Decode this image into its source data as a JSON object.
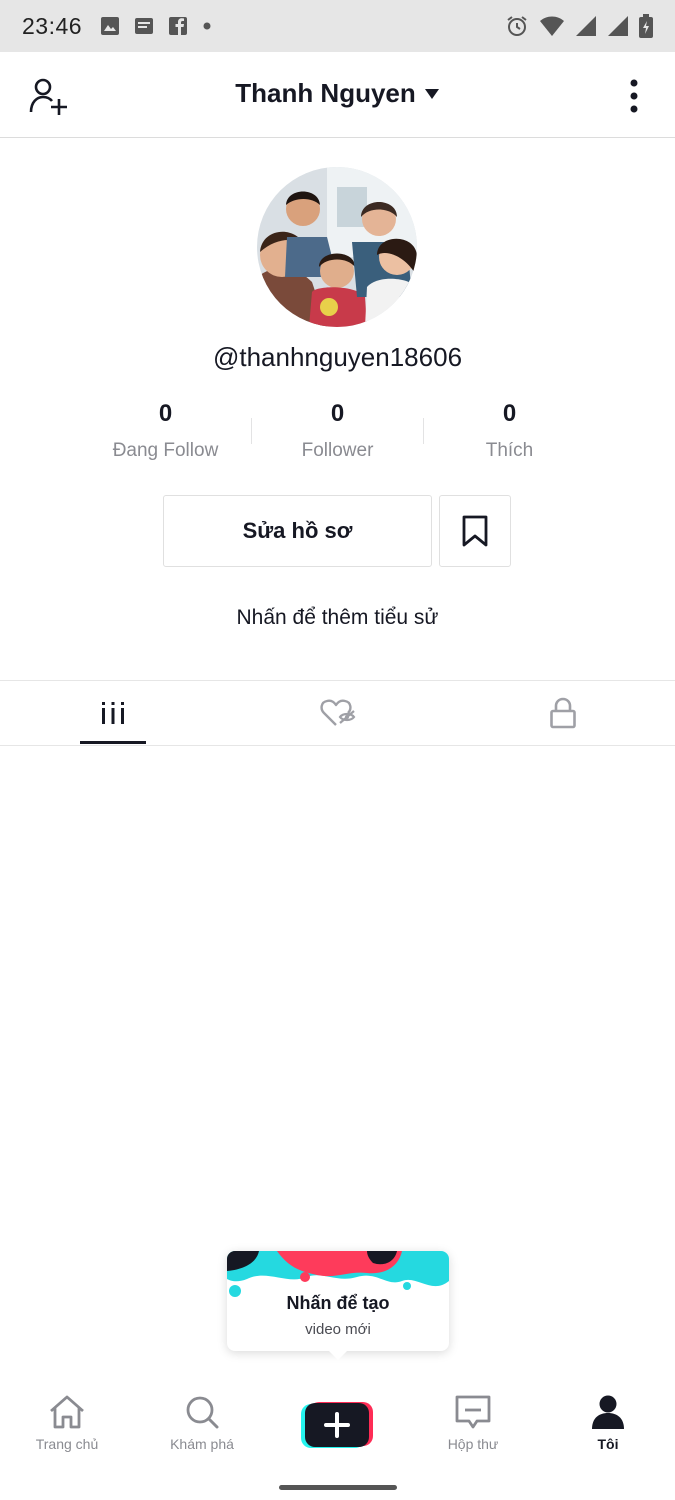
{
  "status_bar": {
    "time": "23:46",
    "left_icons": [
      "image-icon",
      "message-icon",
      "facebook-icon",
      "dot-icon"
    ],
    "right_icons": [
      "alarm-icon",
      "wifi-icon",
      "signal-icon",
      "signal-icon",
      "battery-icon"
    ]
  },
  "header": {
    "title": "Thanh Nguyen",
    "add_user_icon": "add-user-icon",
    "more_icon": "more-vertical-icon"
  },
  "profile": {
    "handle": "@thanhnguyen18606",
    "stats": [
      {
        "value": "0",
        "label": "Đang Follow"
      },
      {
        "value": "0",
        "label": "Follower"
      },
      {
        "value": "0",
        "label": "Thích"
      }
    ],
    "edit_button": "Sửa hồ sơ",
    "bio_prompt": "Nhấn để thêm tiểu sử"
  },
  "tabs": [
    {
      "icon": "grid-icon",
      "active": true
    },
    {
      "icon": "liked-hidden-icon",
      "active": false
    },
    {
      "icon": "lock-icon",
      "active": false
    }
  ],
  "tooltip": {
    "title": "Nhấn để tạo",
    "subtitle": "video mới"
  },
  "bottom_nav": [
    {
      "label": "Trang chủ",
      "icon": "home-icon",
      "active": false
    },
    {
      "label": "Khám phá",
      "icon": "search-icon",
      "active": false
    },
    {
      "label": "",
      "icon": "create-icon",
      "active": false
    },
    {
      "label": "Hộp thư",
      "icon": "inbox-icon",
      "active": false
    },
    {
      "label": "Tôi",
      "icon": "profile-icon",
      "active": true
    }
  ],
  "colors": {
    "text_primary": "#161823",
    "text_secondary": "#8a8b91",
    "accent_cyan": "#25f4ee",
    "accent_red": "#fe2c55"
  }
}
